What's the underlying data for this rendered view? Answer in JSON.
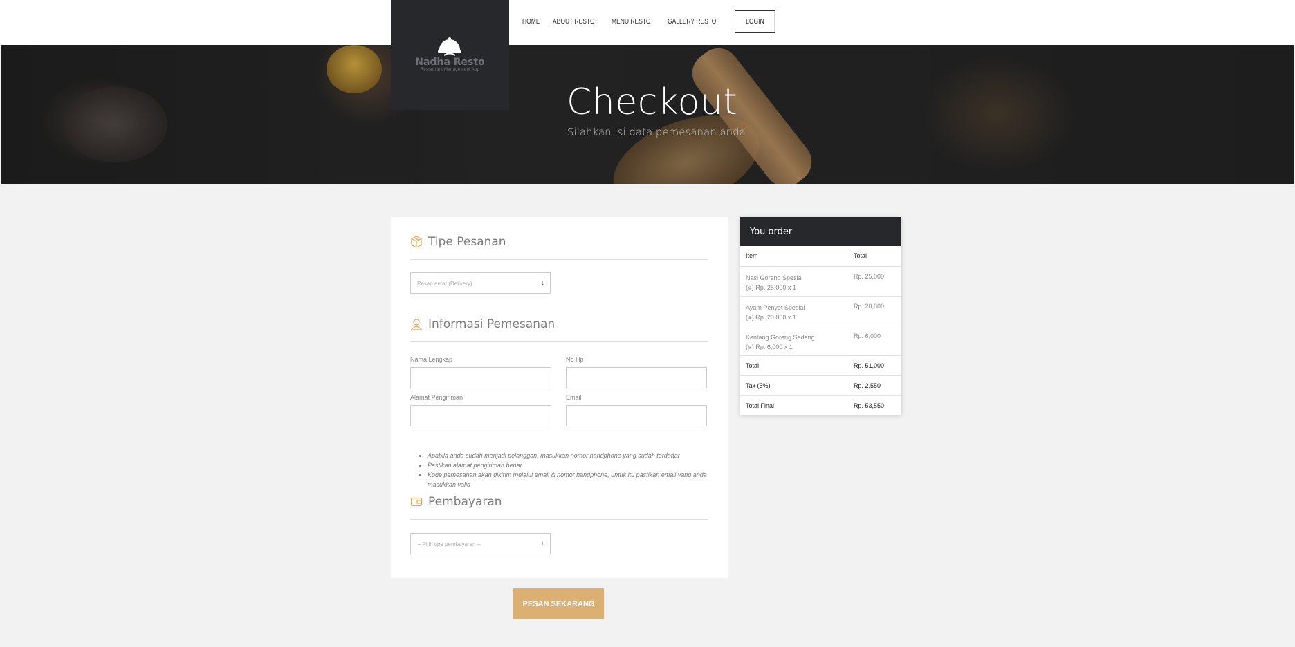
{
  "brand": {
    "name": "Nadha Resto",
    "tagline": "Restaurant Management App"
  },
  "nav": {
    "home": "HOME",
    "about": "ABOUT RESTO",
    "menu": "MENU RESTO",
    "gallery": "GALLERY RESTO",
    "login": "LOGIN"
  },
  "hero": {
    "title": "Checkout",
    "subtitle": "Silahkan isi data pemesanan anda"
  },
  "form": {
    "order_type": {
      "title": "Tipe Pesanan",
      "value": "Pesan antar (Delivery)"
    },
    "info": {
      "title": "Informasi Pemesanan",
      "name_label": "Nama Lengkap",
      "phone_label": "No Hp",
      "address_label": "Alamat Pengiriman",
      "email_label": "Email"
    },
    "notes": [
      "Apabila anda sudah menjadi pelanggan, masukkan nomor handphone yang sudah terdaftar",
      "Pastikan alamat pengiriman benar",
      "Kode pemesanan akan dikirim melalui email & nomor handphone, untuk itu pastikan email yang anda masukkan valid"
    ],
    "payment": {
      "title": "Pembayaran",
      "placeholder": "-- Pilih tipe pembayaran --"
    },
    "submit_label": "PESAN SEKARANG"
  },
  "order": {
    "title": "You order",
    "col_item": "Item",
    "col_total": "Total",
    "items": [
      {
        "name": "Nasi Goreng Spesial",
        "detail": "Rp. 25,000 x 1",
        "total": "Rp. 25,000"
      },
      {
        "name": "Ayam Penyet Spesial",
        "detail": "Rp. 20,000 x 1",
        "total": "Rp. 20,000"
      },
      {
        "name": "Kentang Goreng Sedang",
        "detail": "Rp. 6,000 x 1",
        "total": "Rp. 6,000"
      }
    ],
    "total_label": "Total",
    "total_value": "Rp. 51,000",
    "tax_label": "Tax (5%)",
    "tax_value": "Rp. 2,550",
    "final_label": "Total Final",
    "final_value": "Rp. 53,550"
  },
  "colors": {
    "accent": "#dcaf73",
    "dark": "#26282b",
    "icon": "#e0a95e"
  }
}
